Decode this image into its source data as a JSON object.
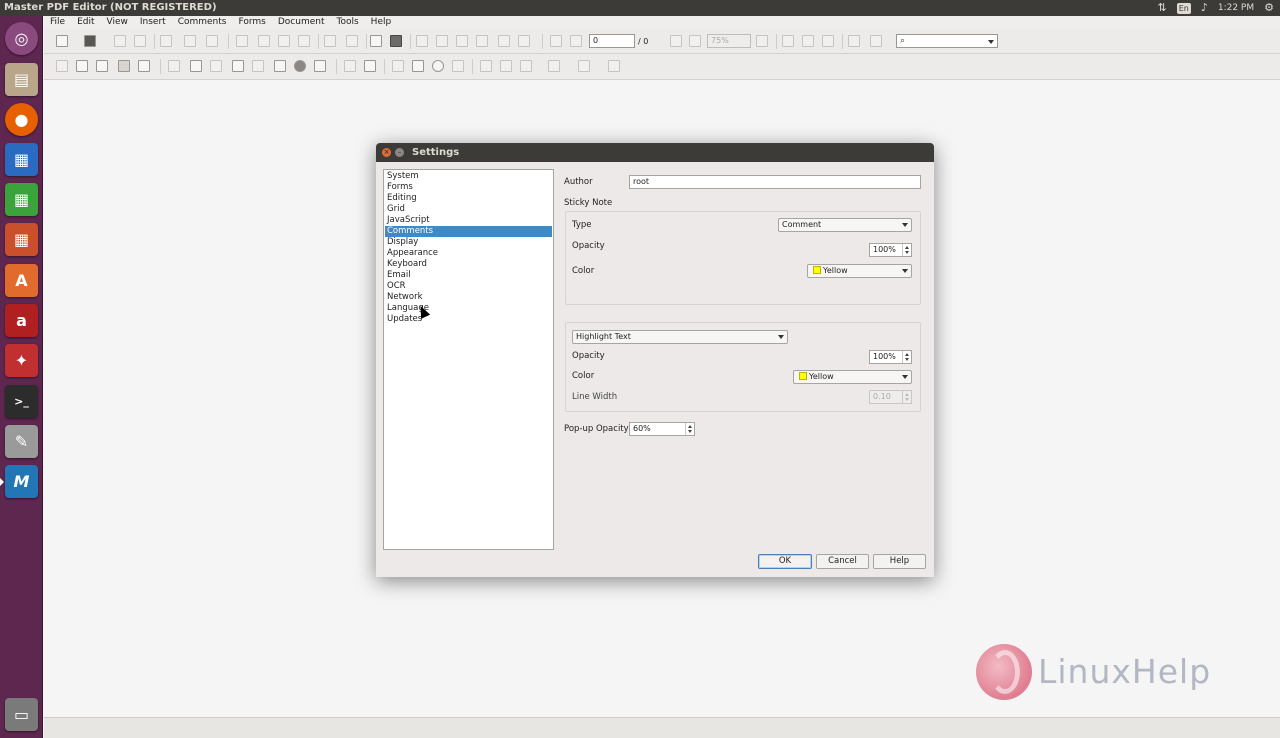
{
  "window": {
    "title": "Master PDF Editor (NOT REGISTERED)"
  },
  "top_panel": {
    "lang": "En",
    "volume_icon": "volume-icon",
    "network_icon": "network-arrows-icon",
    "time": "1:22 PM",
    "settings_icon": "gear-icon"
  },
  "launcher": {
    "items": [
      {
        "name": "ubuntu-dash-icon",
        "glyph": "◎",
        "color": "#8a4a7e"
      },
      {
        "name": "files-icon",
        "glyph": "▤",
        "color": "#b9a58a"
      },
      {
        "name": "firefox-icon",
        "glyph": "●",
        "color": "#e66000"
      },
      {
        "name": "writer-icon",
        "glyph": "▦",
        "color": "#2a6ac1"
      },
      {
        "name": "calc-icon",
        "glyph": "▦",
        "color": "#3ba33b"
      },
      {
        "name": "impress-icon",
        "glyph": "▦",
        "color": "#c9502a"
      },
      {
        "name": "software-center-icon",
        "glyph": "A",
        "color": "#e06b2c"
      },
      {
        "name": "amazon-icon",
        "glyph": "a",
        "color": "#b02020"
      },
      {
        "name": "system-settings-icon",
        "glyph": "✦",
        "color": "#c13030"
      },
      {
        "name": "terminal-icon",
        "glyph": ">_",
        "color": "#2c2c2c"
      },
      {
        "name": "text-editor-icon",
        "glyph": "✎",
        "color": "#9a9a9a"
      },
      {
        "name": "master-pdf-icon",
        "glyph": "M",
        "color": "#2276b5"
      },
      {
        "name": "trash-icon",
        "glyph": "▭",
        "color": "#7a7a7a"
      }
    ]
  },
  "menubar": [
    "File",
    "Edit",
    "View",
    "Insert",
    "Comments",
    "Forms",
    "Document",
    "Tools",
    "Help"
  ],
  "toolbar": {
    "page_value": "0",
    "page_total": "/ 0",
    "zoom_value": "75%",
    "search_icon": "search-icon"
  },
  "dialog": {
    "title": "Settings",
    "categories": [
      "System",
      "Forms",
      "Editing",
      "Grid",
      "JavaScript",
      "Comments",
      "Display",
      "Appearance",
      "Keyboard",
      "Email",
      "OCR",
      "Network",
      "Language",
      "Updates"
    ],
    "selected_category": "Comments",
    "author_label": "Author",
    "author_value": "root",
    "sticky_note_label": "Sticky Note",
    "sticky": {
      "type_label": "Type",
      "type_value": "Comment",
      "opacity_label": "Opacity",
      "opacity_value": "100%",
      "color_label": "Color",
      "color_value": "Yellow"
    },
    "highlight": {
      "mode_value": "Highlight Text",
      "opacity_label": "Opacity",
      "opacity_value": "100%",
      "color_label": "Color",
      "color_value": "Yellow",
      "line_width_label": "Line Width",
      "line_width_value": "0.10"
    },
    "popup_opacity_label": "Pop-up Opacity",
    "popup_opacity_value": "60%",
    "buttons": {
      "ok": "OK",
      "cancel": "Cancel",
      "help": "Help"
    },
    "yellow": "#ffff00",
    "selection_color": "#3d8ac9"
  },
  "watermark": {
    "text": "LinuxHelp"
  }
}
